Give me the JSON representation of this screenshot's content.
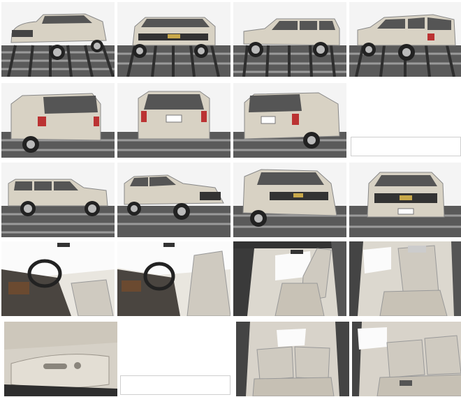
{
  "gallery": {
    "photos": [
      {
        "id": "front-left-34"
      },
      {
        "id": "front-center"
      },
      {
        "id": "left-side"
      },
      {
        "id": "rear-left-34"
      },
      {
        "id": "rear-left-close"
      },
      {
        "id": "rear-center"
      },
      {
        "id": "rear-right-34"
      },
      {
        "id": "blank-1"
      },
      {
        "id": "right-side"
      },
      {
        "id": "front-right-34"
      },
      {
        "id": "front-right-low"
      },
      {
        "id": "front-straight"
      },
      {
        "id": "dash-driver-1"
      },
      {
        "id": "dash-driver-2"
      },
      {
        "id": "front-seats-open-door"
      },
      {
        "id": "front-seats-close"
      },
      {
        "id": "seat-controls"
      },
      {
        "id": "blank-2"
      },
      {
        "id": "rear-seats-1"
      },
      {
        "id": "rear-seats-2"
      }
    ]
  },
  "colors": {
    "car_body": "#d8d2c4",
    "floor_dark": "#3a3a3a",
    "floor_light": "#9a9a9a",
    "interior": "#cfcac0"
  }
}
